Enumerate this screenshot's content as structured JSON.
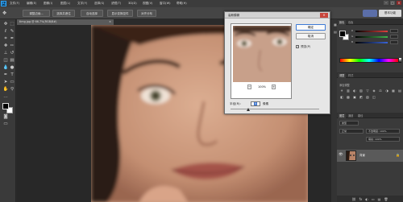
{
  "app": {
    "logo": "Ps"
  },
  "menu": [
    "文件(F)",
    "编辑(E)",
    "图像(I)",
    "图层(L)",
    "文字(Y)",
    "选择(S)",
    "滤镜(T)",
    "3D(D)",
    "视图(V)",
    "窗口(W)",
    "帮助(H)"
  ],
  "window_controls": {
    "minimize": "–",
    "maximize": "□",
    "close": "×"
  },
  "options_bar": {
    "tool_icon": "move-icon",
    "buttons": [
      "调整边缘...",
      "选择并遮住",
      "自动选择",
      "显示变换控件",
      "对齐分布"
    ],
    "workspace": "基本功能"
  },
  "document": {
    "tab_title": "timg.jpg @ 66.7%(RGB/8#)",
    "tab_close": "×"
  },
  "dialog": {
    "title": "高斯模糊",
    "close": "×",
    "ok_label": "确定",
    "cancel_label": "取消",
    "preview_label": "预览(P)",
    "preview_checked": true,
    "zoom_value": "100%",
    "zoom_minus": "−",
    "zoom_plus": "+",
    "radius_label": "半径(R):",
    "radius_value": "5",
    "radius_unit": "像素",
    "radius_fraction": 0.2
  },
  "panels": {
    "color_tabs": [
      "颜色",
      "色板"
    ],
    "channels": [
      {
        "label": "R",
        "color": "#e0403c"
      },
      {
        "label": "G",
        "color": "#3fb54a"
      },
      {
        "label": "B",
        "color": "#3a64d6"
      }
    ],
    "adjustments_tabs": [
      "调整",
      "样式"
    ],
    "adjustments_title": "添加调整",
    "adj_icons": [
      "☀",
      "▥",
      "◐",
      "▨",
      "▽",
      "◈",
      "⚖",
      "◑",
      "▦",
      "▤",
      "◧",
      "▩",
      "▣",
      "◩",
      "▧",
      "◫"
    ],
    "layers_tabs": [
      "图层",
      "通道",
      "路径"
    ],
    "layer_kind": "类型",
    "blend_mode": "正常",
    "opacity": "不透明度: 100%",
    "fill": "填充: 100%",
    "layer_name": "背景",
    "layer_icons": [
      "⛓",
      "fx",
      "◐",
      "▭",
      "▤",
      "🗑"
    ]
  },
  "colors": {
    "ps_accent": "#31a8ff",
    "dialog_ok_border": "#3d7ad6"
  }
}
